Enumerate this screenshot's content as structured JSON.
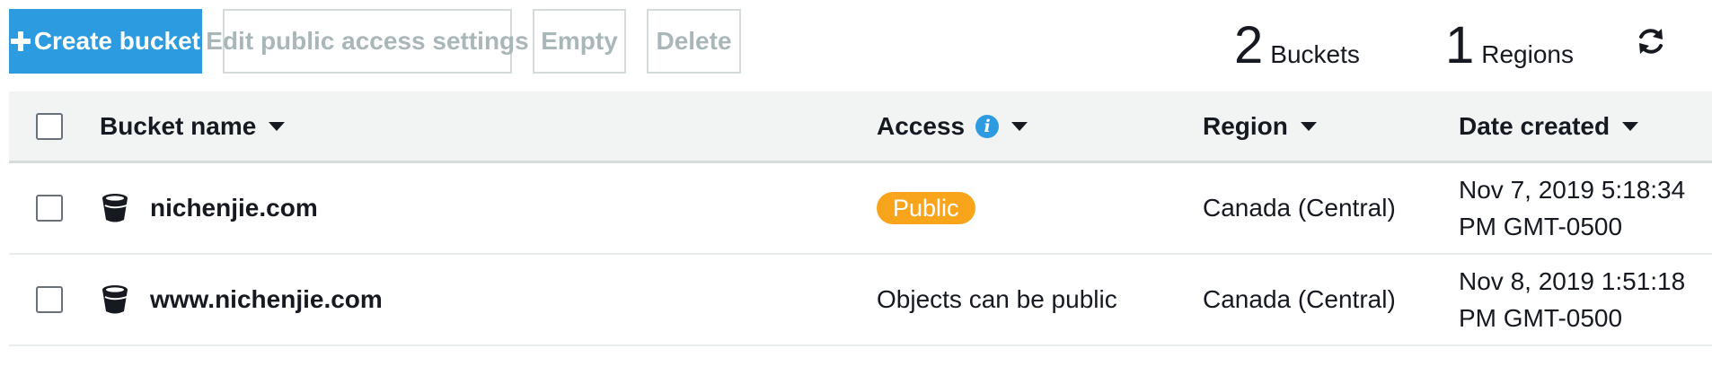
{
  "toolbar": {
    "create_label": "Create bucket",
    "edit_label": "Edit public access settings",
    "empty_label": "Empty",
    "delete_label": "Delete"
  },
  "stats": {
    "buckets_count": "2",
    "buckets_label": "Buckets",
    "regions_count": "1",
    "regions_label": "Regions"
  },
  "icons": {
    "create": "plus-icon",
    "refresh": "refresh-icon",
    "sort": "caret-down-icon",
    "info": "info-icon",
    "bucket": "bucket-icon"
  },
  "table": {
    "columns": {
      "name": "Bucket name",
      "access": "Access",
      "region": "Region",
      "date": "Date created"
    },
    "rows": [
      {
        "name": "nichenjie.com",
        "access": "Public",
        "access_is_badge": true,
        "region": "Canada (Central)",
        "date": "Nov 7, 2019 5:18:34 PM GMT-0500"
      },
      {
        "name": "www.nichenjie.com",
        "access": "Objects can be public",
        "access_is_badge": false,
        "region": "Canada (Central)",
        "date": "Nov 8, 2019 1:51:18 PM GMT-0500"
      }
    ]
  },
  "colors": {
    "primary": "#2d9be0",
    "public_badge": "#f8a51c",
    "header_bg": "#f2f3f3",
    "disabled_text": "#aab7b8"
  }
}
